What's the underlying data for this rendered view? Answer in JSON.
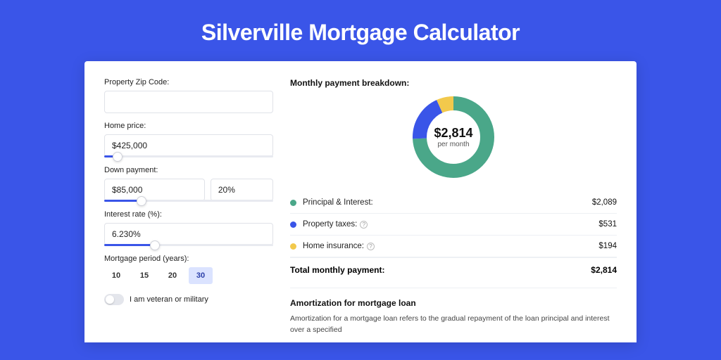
{
  "title": "Silverville Mortgage Calculator",
  "form": {
    "zip": {
      "label": "Property Zip Code:",
      "value": ""
    },
    "home_price": {
      "label": "Home price:",
      "value": "$425,000",
      "slider_pct": 8
    },
    "down_payment": {
      "label": "Down payment:",
      "amount": "$85,000",
      "percent": "20%",
      "slider_pct": 22
    },
    "interest_rate": {
      "label": "Interest rate (%):",
      "value": "6.230%",
      "slider_pct": 30
    },
    "period": {
      "label": "Mortgage period (years):",
      "options": [
        "10",
        "15",
        "20",
        "30"
      ],
      "active": "30"
    },
    "veteran": {
      "label": "I am veteran or military",
      "on": false
    }
  },
  "breakdown": {
    "title": "Monthly payment breakdown:",
    "center_amount": "$2,814",
    "center_sub": "per month",
    "items": [
      {
        "label": "Principal & Interest:",
        "value": "$2,089",
        "color": "#4aa789",
        "info": false
      },
      {
        "label": "Property taxes:",
        "value": "$531",
        "color": "#3a55e8",
        "info": true
      },
      {
        "label": "Home insurance:",
        "value": "$194",
        "color": "#f2c94c",
        "info": true
      }
    ],
    "total_label": "Total monthly payment:",
    "total_value": "$2,814"
  },
  "chart_data": {
    "type": "pie",
    "title": "Monthly payment breakdown",
    "series": [
      {
        "name": "Principal & Interest",
        "value": 2089,
        "color": "#4aa789"
      },
      {
        "name": "Property taxes",
        "value": 531,
        "color": "#3a55e8"
      },
      {
        "name": "Home insurance",
        "value": 194,
        "color": "#f2c94c"
      }
    ],
    "total": 2814
  },
  "amortization": {
    "title": "Amortization for mortgage loan",
    "text": "Amortization for a mortgage loan refers to the gradual repayment of the loan principal and interest over a specified"
  }
}
